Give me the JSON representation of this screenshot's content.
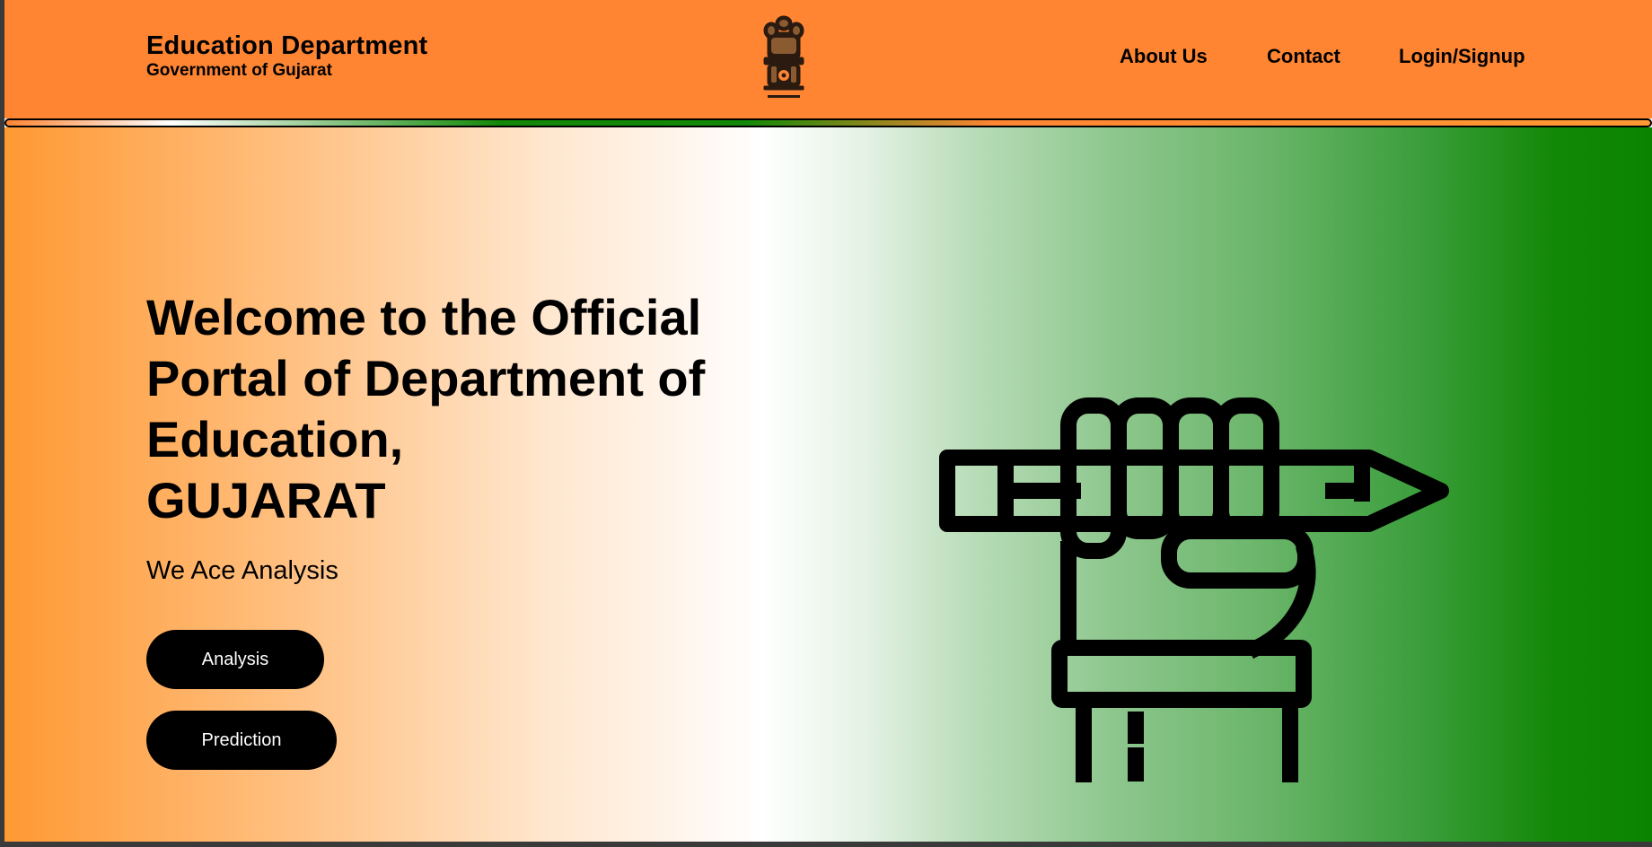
{
  "header": {
    "title": "Education Department",
    "subtitle": "Government of Gujarat",
    "emblem_icon": "national-emblem-icon",
    "nav": [
      {
        "label": "About Us"
      },
      {
        "label": "Contact"
      },
      {
        "label": "Login/Signup"
      }
    ],
    "background_color": "#ff8533"
  },
  "hero": {
    "title_lines": [
      "Welcome to the Official",
      "Portal of Department of",
      "Education,",
      "GUJARAT"
    ],
    "tagline": "We Ace Analysis",
    "buttons": [
      {
        "label": "Analysis"
      },
      {
        "label": "Prediction"
      }
    ],
    "illustration_icon": "fist-holding-pencil-icon",
    "gradient_colors": [
      "#ff9933",
      "#ffffff",
      "#138808"
    ]
  }
}
